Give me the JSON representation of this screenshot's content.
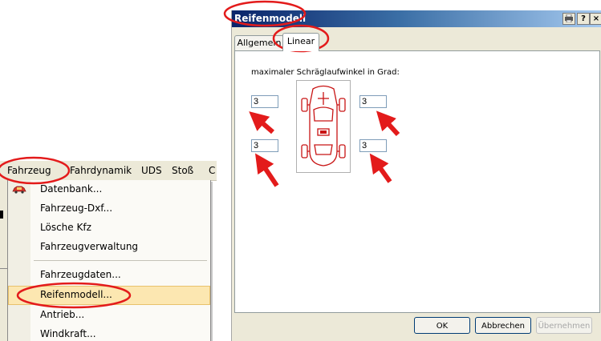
{
  "menubar": {
    "items": [
      "Fahrzeug",
      "Fahrdynamik",
      "UDS",
      "Stoß",
      "C"
    ]
  },
  "dropdown": {
    "items": [
      {
        "label": "Datenbank...",
        "icon": "database-car-icon"
      },
      {
        "label": "Fahrzeug-Dxf..."
      },
      {
        "label": "Lösche Kfz"
      },
      {
        "label": "Fahrzeugverwaltung"
      },
      {
        "label": "Fahrzeugdaten..."
      },
      {
        "label": "Reifenmodell...",
        "selected": true
      },
      {
        "label": "Antrieb..."
      },
      {
        "label": "Windkraft..."
      }
    ]
  },
  "dialog": {
    "title": "Reifenmodell",
    "title_buttons": [
      "?",
      "×"
    ],
    "tabs": [
      {
        "label": "Allgemein",
        "active": false
      },
      {
        "label": "Linear",
        "active": true
      }
    ],
    "caption": "maximaler Schräglaufwinkel in Grad:",
    "fields": {
      "front_left": "3",
      "front_right": "3",
      "rear_left": "3",
      "rear_right": "3"
    },
    "buttons": {
      "ok": "OK",
      "cancel": "Abbrechen",
      "apply": "Übernehmen"
    }
  },
  "colors": {
    "highlight_red": "#e31b1b",
    "menu_selected": "#fce7b1",
    "title_blue": "#0a246a"
  }
}
